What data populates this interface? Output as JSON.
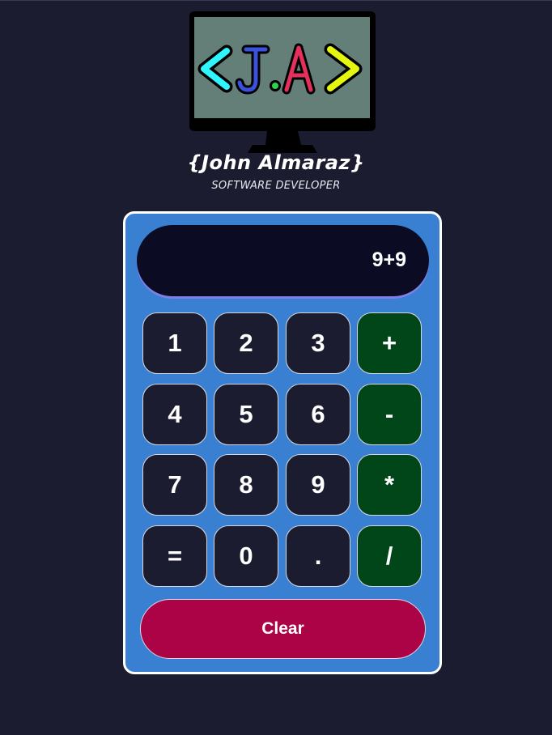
{
  "header": {
    "logo_text": "<J.A>",
    "name": "{John Almaraz}",
    "subtitle": "SOFTWARE DEVELOPER"
  },
  "calculator": {
    "display_value": "9+9",
    "keys": [
      [
        "1",
        "2",
        "3",
        "+"
      ],
      [
        "4",
        "5",
        "6",
        "-"
      ],
      [
        "7",
        "8",
        "9",
        "*"
      ],
      [
        "=",
        "0",
        ".",
        "/"
      ]
    ],
    "clear_label": "Clear"
  },
  "colors": {
    "page_background": "#1c1c31",
    "calculator_background": "#3a80d2",
    "display_background": "#0b0b24",
    "key_background": "#1c1c31",
    "operator_key_background": "#004619",
    "clear_button_background": "#ac0346",
    "logo_screen": "#647f78",
    "logo_chevron_left": "#2ff5ff",
    "logo_letter_j": "#3b52df",
    "logo_dot": "#2fd14a",
    "logo_letter_a": "#e5305e",
    "logo_chevron_right": "#e4f70f"
  }
}
